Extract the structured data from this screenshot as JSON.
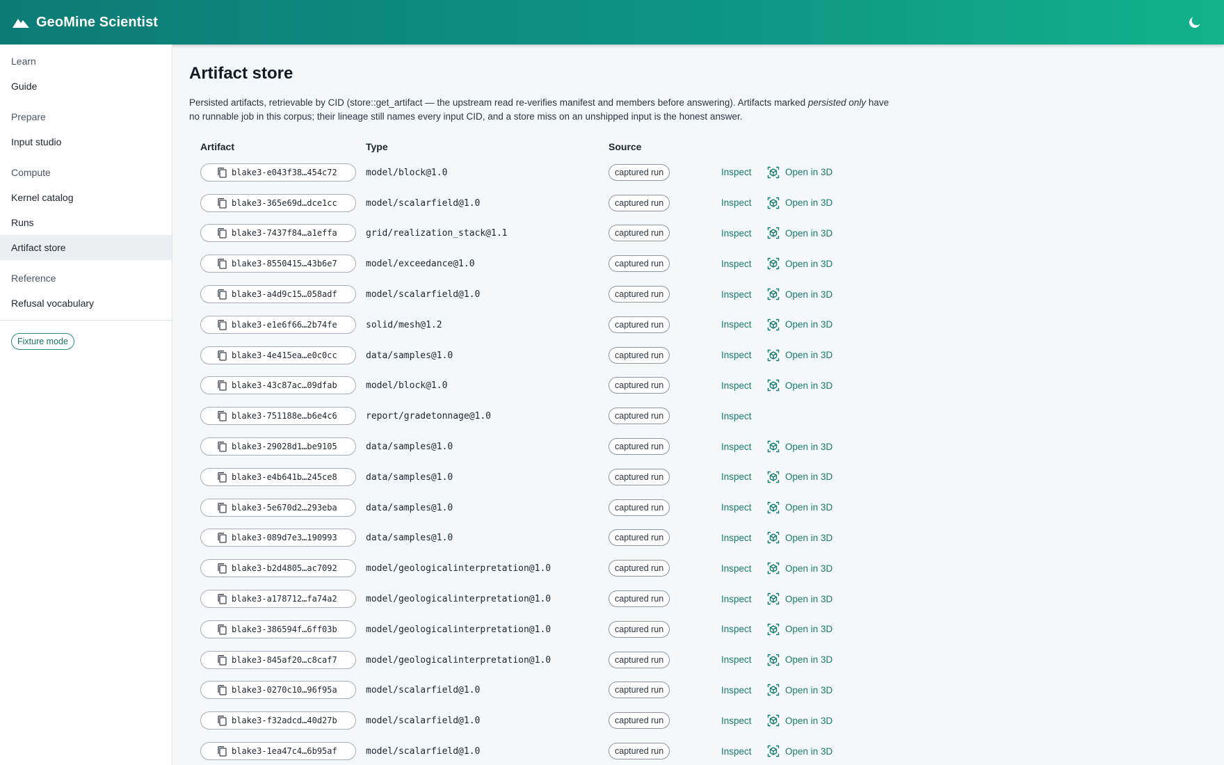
{
  "app": {
    "title": "GeoMine Scientist",
    "logo_icon": "mountain-icon",
    "theme_icon": "moon-icon",
    "accent": "#0e9585"
  },
  "sidebar": {
    "sections": [
      {
        "label": "Learn",
        "items": [
          {
            "label": "Guide"
          }
        ]
      },
      {
        "label": "Prepare",
        "items": [
          {
            "label": "Input studio"
          }
        ]
      },
      {
        "label": "Compute",
        "items": [
          {
            "label": "Kernel catalog"
          },
          {
            "label": "Runs"
          },
          {
            "label": "Artifact store"
          }
        ]
      },
      {
        "label": "Reference",
        "items": [
          {
            "label": "Refusal vocabulary"
          }
        ]
      }
    ],
    "fixture_label": "Fixture mode"
  },
  "page": {
    "title": "Artifact store",
    "desc_part1": "Persisted artifacts, retrievable by CID (store::get_artifact — the upstream read re-verifies manifest and members before answering). Artifacts marked ",
    "desc_em": "persisted only",
    "desc_part2": " have no runnable job in this corpus; their lineage still names every input CID, and a store miss on an unshipped input is the honest answer."
  },
  "table": {
    "headers": {
      "artifact": "Artifact",
      "type": "Type",
      "source": "Source"
    },
    "inspect_label": "Inspect",
    "open3d_label": "Open in 3D",
    "rows": [
      {
        "cid": "blake3-e043f38…454c72",
        "type": "model/block@1.0",
        "source": "captured run",
        "open3d": true
      },
      {
        "cid": "blake3-365e69d…dce1cc",
        "type": "model/scalarfield@1.0",
        "source": "captured run",
        "open3d": true
      },
      {
        "cid": "blake3-7437f84…a1effa",
        "type": "grid/realization_stack@1.1",
        "source": "captured run",
        "open3d": true
      },
      {
        "cid": "blake3-8550415…43b6e7",
        "type": "model/exceedance@1.0",
        "source": "captured run",
        "open3d": true
      },
      {
        "cid": "blake3-a4d9c15…058adf",
        "type": "model/scalarfield@1.0",
        "source": "captured run",
        "open3d": true
      },
      {
        "cid": "blake3-e1e6f66…2b74fe",
        "type": "solid/mesh@1.2",
        "source": "captured run",
        "open3d": true
      },
      {
        "cid": "blake3-4e415ea…e0c0cc",
        "type": "data/samples@1.0",
        "source": "captured run",
        "open3d": true
      },
      {
        "cid": "blake3-43c87ac…09dfab",
        "type": "model/block@1.0",
        "source": "captured run",
        "open3d": true
      },
      {
        "cid": "blake3-751188e…b6e4c6",
        "type": "report/gradetonnage@1.0",
        "source": "captured run",
        "open3d": false
      },
      {
        "cid": "blake3-29028d1…be9105",
        "type": "data/samples@1.0",
        "source": "captured run",
        "open3d": true
      },
      {
        "cid": "blake3-e4b641b…245ce8",
        "type": "data/samples@1.0",
        "source": "captured run",
        "open3d": true
      },
      {
        "cid": "blake3-5e670d2…293eba",
        "type": "data/samples@1.0",
        "source": "captured run",
        "open3d": true
      },
      {
        "cid": "blake3-089d7e3…190993",
        "type": "data/samples@1.0",
        "source": "captured run",
        "open3d": true
      },
      {
        "cid": "blake3-b2d4805…ac7092",
        "type": "model/geologicalinterpretation@1.0",
        "source": "captured run",
        "open3d": true
      },
      {
        "cid": "blake3-a178712…fa74a2",
        "type": "model/geologicalinterpretation@1.0",
        "source": "captured run",
        "open3d": true
      },
      {
        "cid": "blake3-386594f…6ff03b",
        "type": "model/geologicalinterpretation@1.0",
        "source": "captured run",
        "open3d": true
      },
      {
        "cid": "blake3-845af20…c8caf7",
        "type": "model/geologicalinterpretation@1.0",
        "source": "captured run",
        "open3d": true
      },
      {
        "cid": "blake3-0270c10…96f95a",
        "type": "model/scalarfield@1.0",
        "source": "captured run",
        "open3d": true
      },
      {
        "cid": "blake3-f32adcd…40d27b",
        "type": "model/scalarfield@1.0",
        "source": "captured run",
        "open3d": true
      },
      {
        "cid": "blake3-1ea47c4…6b95af",
        "type": "model/scalarfield@1.0",
        "source": "captured run",
        "open3d": true
      }
    ]
  }
}
